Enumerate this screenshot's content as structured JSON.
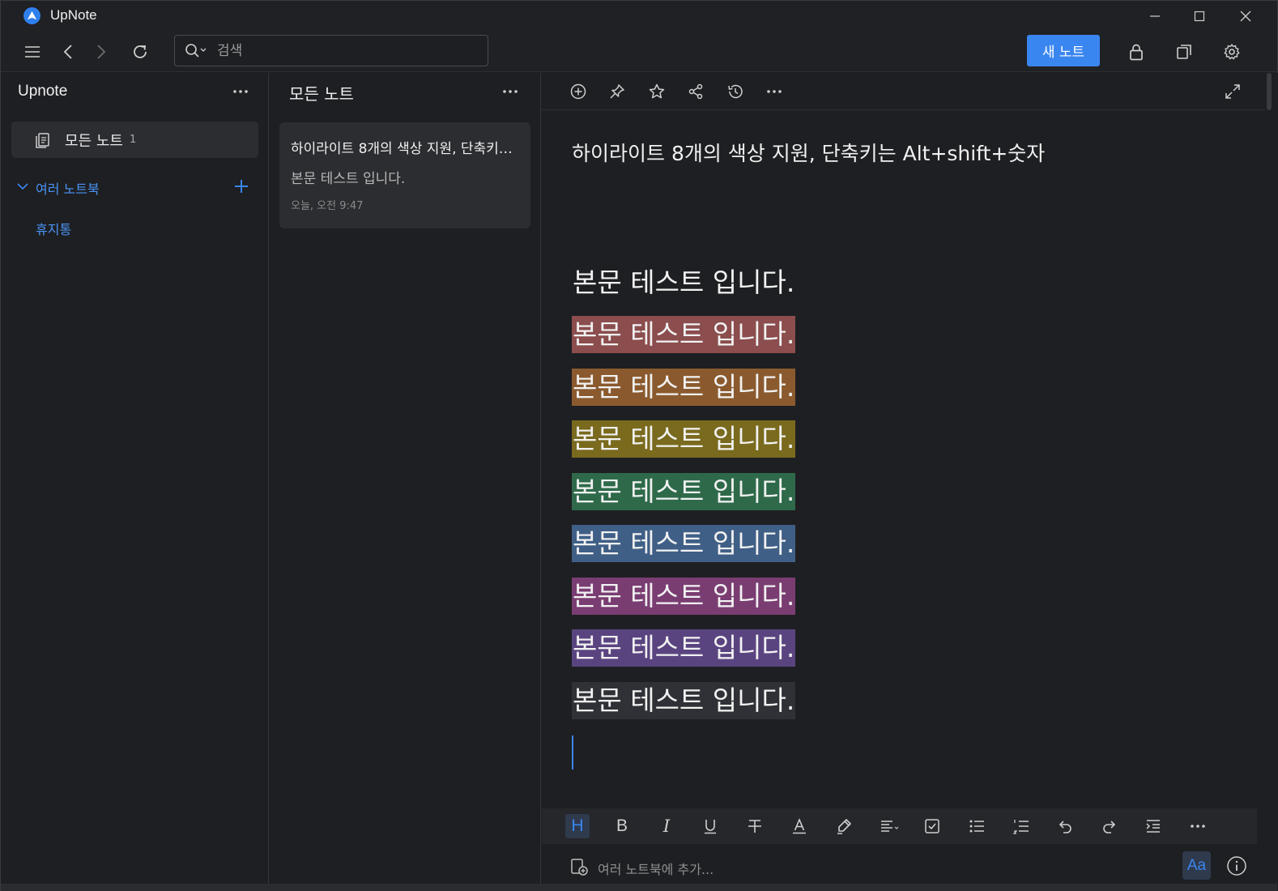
{
  "app": {
    "title": "UpNote"
  },
  "toolbar": {
    "search_placeholder": "검색",
    "new_note_label": "새 노트"
  },
  "sidebar": {
    "title": "Upnote",
    "all_notes_label": "모든 노트",
    "all_notes_count": "1",
    "notebooks_label": "여러 노트북",
    "trash_label": "휴지통"
  },
  "note_list": {
    "title": "모든 노트",
    "notes": [
      {
        "title": "하이라이트 8개의 색상 지원, 단축키는 Alt+shift+숫자",
        "preview": "본문 테스트 입니다.",
        "date": "오늘, 오전 9:47"
      }
    ]
  },
  "editor": {
    "title": "하이라이트 8개의 색상 지원, 단축키는 Alt+shift+숫자",
    "paragraphs": [
      {
        "text": "본문 테스트 입니다.",
        "highlight": "none"
      },
      {
        "text": "본문 테스트 입니다.",
        "highlight": "#8b4d4d"
      },
      {
        "text": "본문 테스트 입니다.",
        "highlight": "#8a5a2e"
      },
      {
        "text": "본문 테스트 입니다.",
        "highlight": "#7a6a1e"
      },
      {
        "text": "본문 테스트 입니다.",
        "highlight": "#2e6a4a"
      },
      {
        "text": "본문 테스트 입니다.",
        "highlight": "#3f5f86"
      },
      {
        "text": "본문 테스트 입니다.",
        "highlight": "#7a3d72"
      },
      {
        "text": "본문 테스트 입니다.",
        "highlight": "#5a4480"
      },
      {
        "text": "본문 테스트 입니다.",
        "highlight": "#303136"
      }
    ],
    "add_notebook_placeholder": "여러 노트북에 추가...",
    "font_button_label": "Aa"
  },
  "colors": {
    "accent": "#3a86f0",
    "background": "#1e1f22",
    "card": "#2c2d31"
  }
}
